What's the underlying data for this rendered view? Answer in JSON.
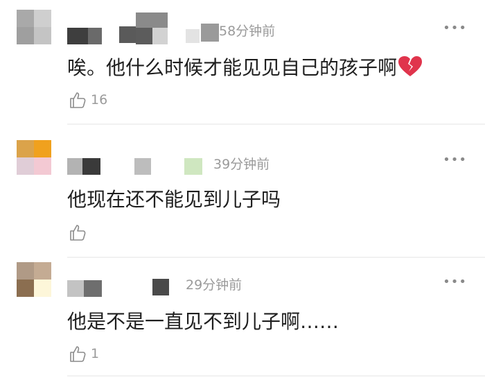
{
  "comments": [
    {
      "time": "58分钟前",
      "text": "唉。他什么时候才能见见自己的孩子啊",
      "likes": "16",
      "emoji": "broken-heart-icon",
      "avatar_colors": [
        "#a9a9a9",
        "#cfcfcf",
        "#9f9f9f",
        "#c4c4c4"
      ]
    },
    {
      "time": "39分钟前",
      "text": "他现在还不能见到儿子吗",
      "likes": "",
      "avatar_colors": [
        "#dba34a",
        "#f0a11e",
        "#e0cdd7",
        "#f3c9d3"
      ]
    },
    {
      "time": "29分钟前",
      "text": "他是不是一直见不到儿子啊……",
      "likes": "1",
      "avatar_colors": [
        "#b09a86",
        "#c4ab93",
        "#8b6e50",
        "#fdf6d9"
      ]
    }
  ],
  "more_label": "•••",
  "colors": {
    "text": "#1f1f1f",
    "muted": "#9a9a9a",
    "like_icon": "#8c8c8c"
  }
}
